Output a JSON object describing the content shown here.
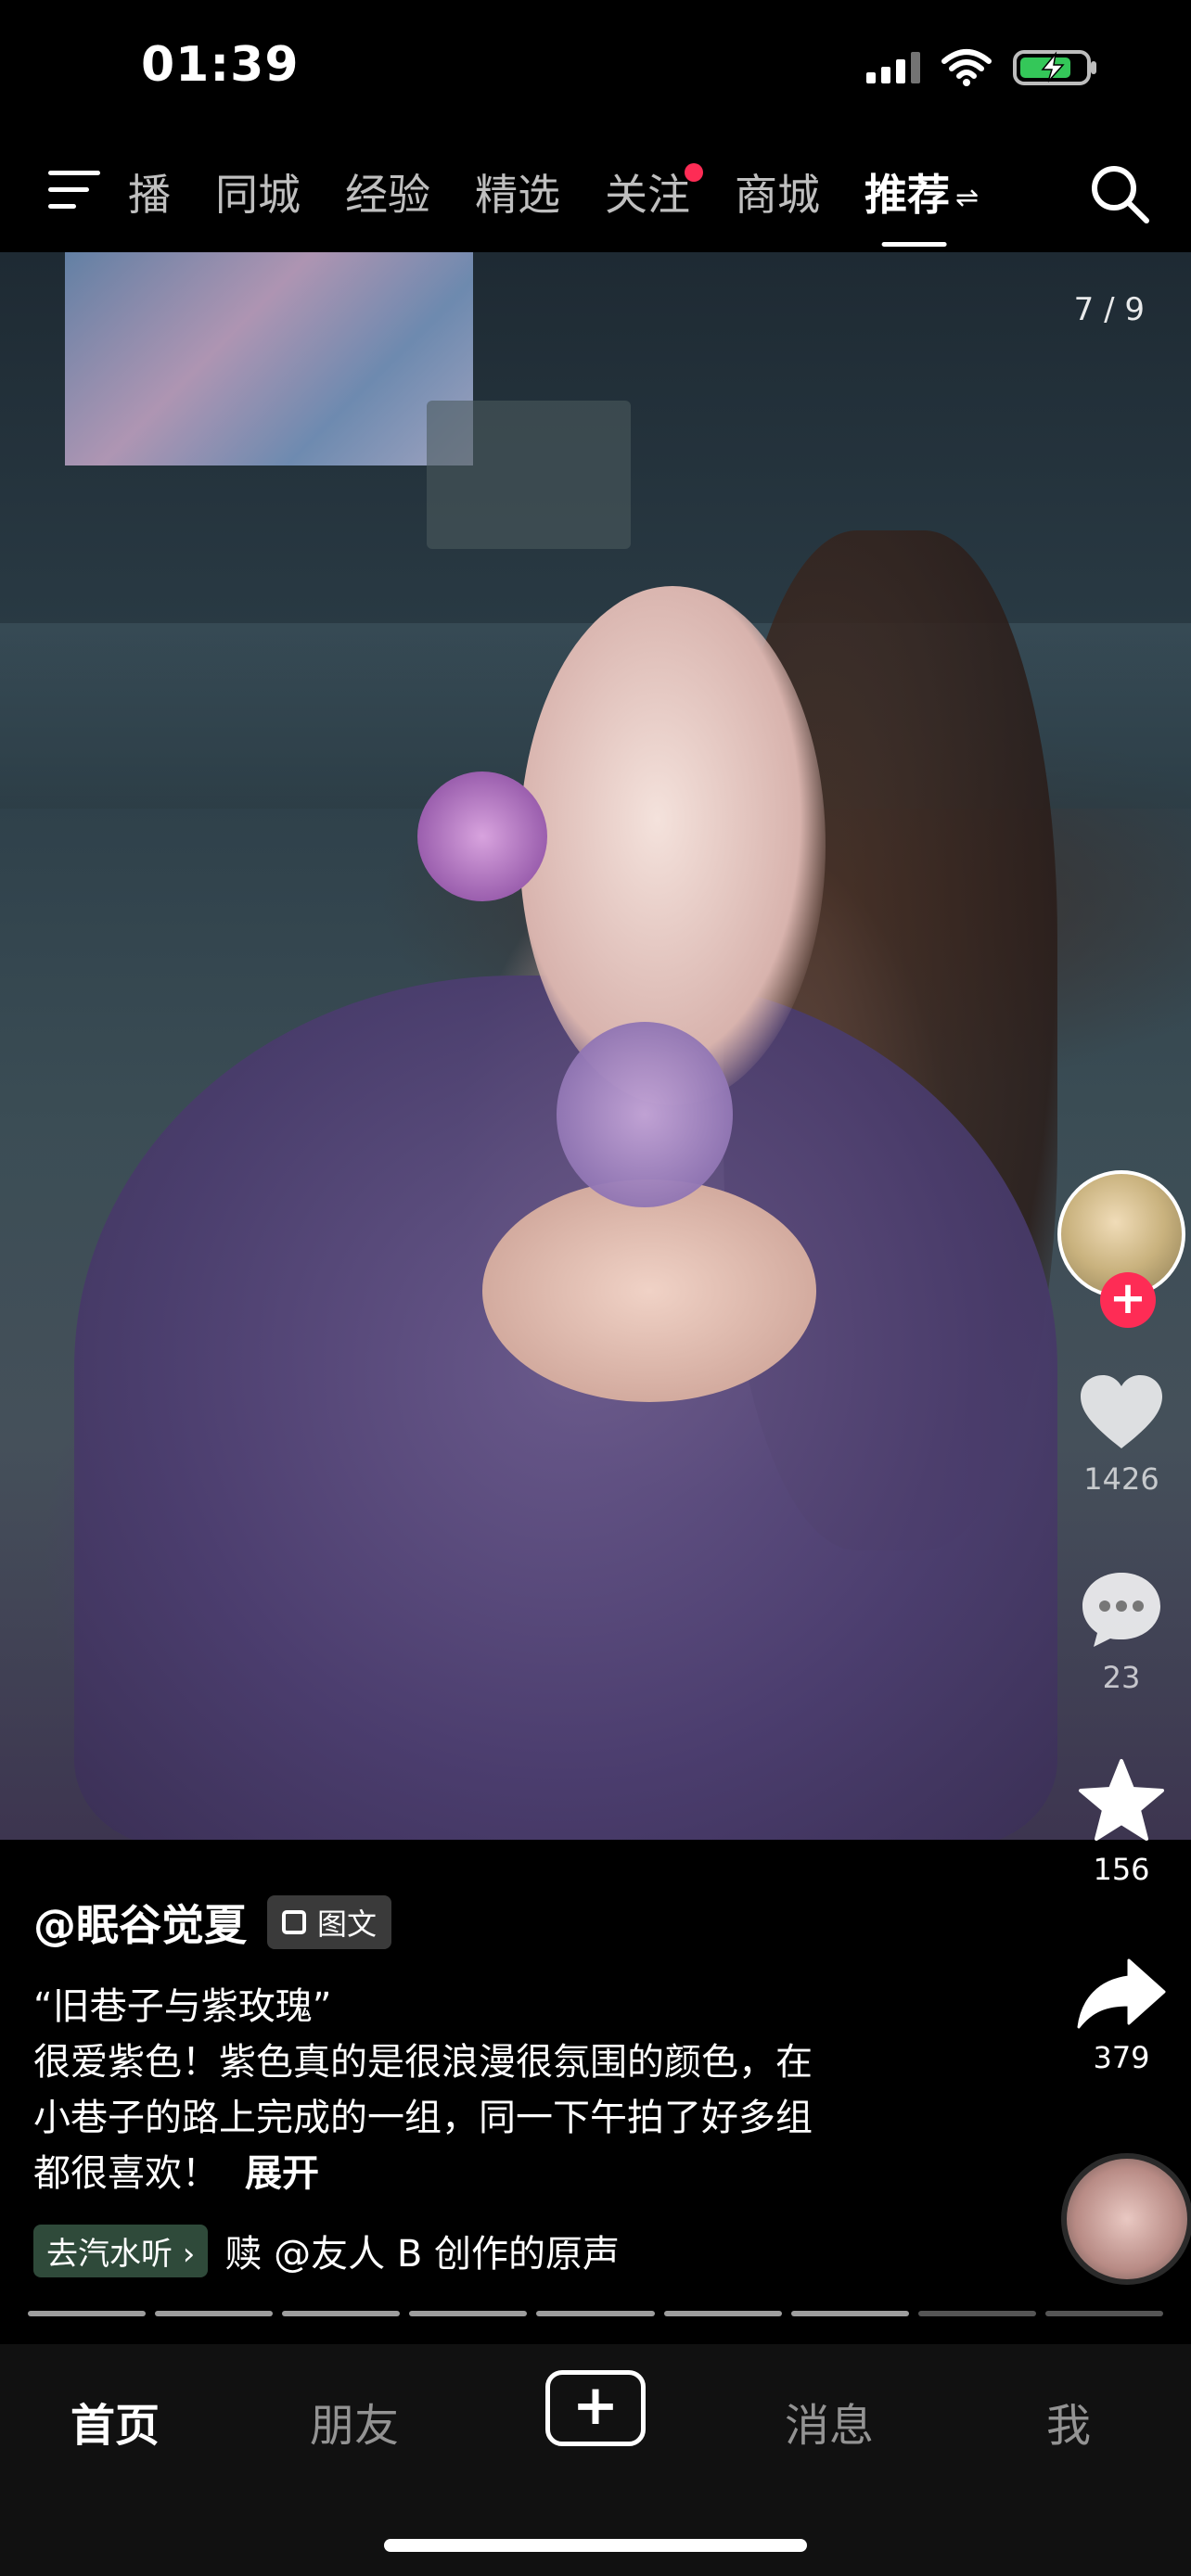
{
  "status_bar": {
    "time": "01:39"
  },
  "top_nav": {
    "tabs": [
      {
        "label": "播",
        "active": false
      },
      {
        "label": "同城",
        "active": false
      },
      {
        "label": "经验",
        "active": false
      },
      {
        "label": "精选",
        "active": false
      },
      {
        "label": "关注",
        "active": false,
        "has_dot": true
      },
      {
        "label": "商城",
        "active": false
      },
      {
        "label": "推荐",
        "active": true
      }
    ],
    "swap_glyph": "⇌"
  },
  "post": {
    "page_counter": "7 / 9",
    "author": "@眠谷觉夏",
    "type_badge": "图文",
    "title_line": "“旧巷子与紫玫瑰”",
    "desc_lines": [
      "很爱紫色！紫色真的是很浪漫很氛围的颜色，在",
      "小巷子的路上完成的一组，同一下午拍了好多组",
      "都很喜欢！"
    ],
    "expand_label": "展开",
    "music_chip": "去汽水听 ›",
    "music_text": "赎    @友人 B 创作的原声",
    "progress": {
      "total_segments": 9,
      "current": 7
    }
  },
  "actions": {
    "follow_plus": "+",
    "likes": "1426",
    "comments": "23",
    "favorites": "156",
    "shares": "379"
  },
  "bottom_tabs": {
    "home": "首页",
    "friends": "朋友",
    "add": "+",
    "messages": "消息",
    "me": "我"
  },
  "colors": {
    "accent_red": "#fe2c55",
    "background": "#000000",
    "tab_bar": "#111111"
  }
}
